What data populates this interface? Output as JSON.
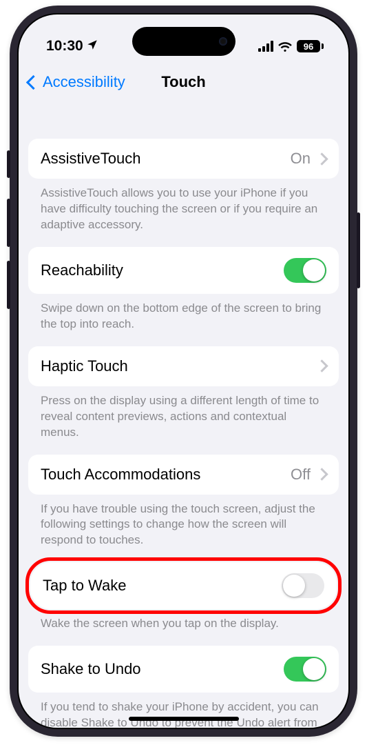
{
  "status": {
    "time": "10:30",
    "battery_pct": "96"
  },
  "nav": {
    "back_label": "Accessibility",
    "title": "Touch"
  },
  "rows": {
    "assistive": {
      "label": "AssistiveTouch",
      "value": "On",
      "footer": "AssistiveTouch allows you to use your iPhone if you have difficulty touching the screen or if you require an adaptive accessory."
    },
    "reachability": {
      "label": "Reachability",
      "footer": "Swipe down on the bottom edge of the screen to bring the top into reach.",
      "on": true
    },
    "haptic": {
      "label": "Haptic Touch",
      "footer": "Press on the display using a different length of time to reveal content previews, actions and contextual menus."
    },
    "accommodations": {
      "label": "Touch Accommodations",
      "value": "Off",
      "footer": "If you have trouble using the touch screen, adjust the following settings to change how the screen will respond to touches."
    },
    "taptowake": {
      "label": "Tap to Wake",
      "footer": "Wake the screen when you tap on the display.",
      "on": false
    },
    "shake": {
      "label": "Shake to Undo",
      "footer": "If you tend to shake your iPhone by accident, you can disable Shake to Undo to prevent the Undo alert from appearing.",
      "on": true
    }
  }
}
